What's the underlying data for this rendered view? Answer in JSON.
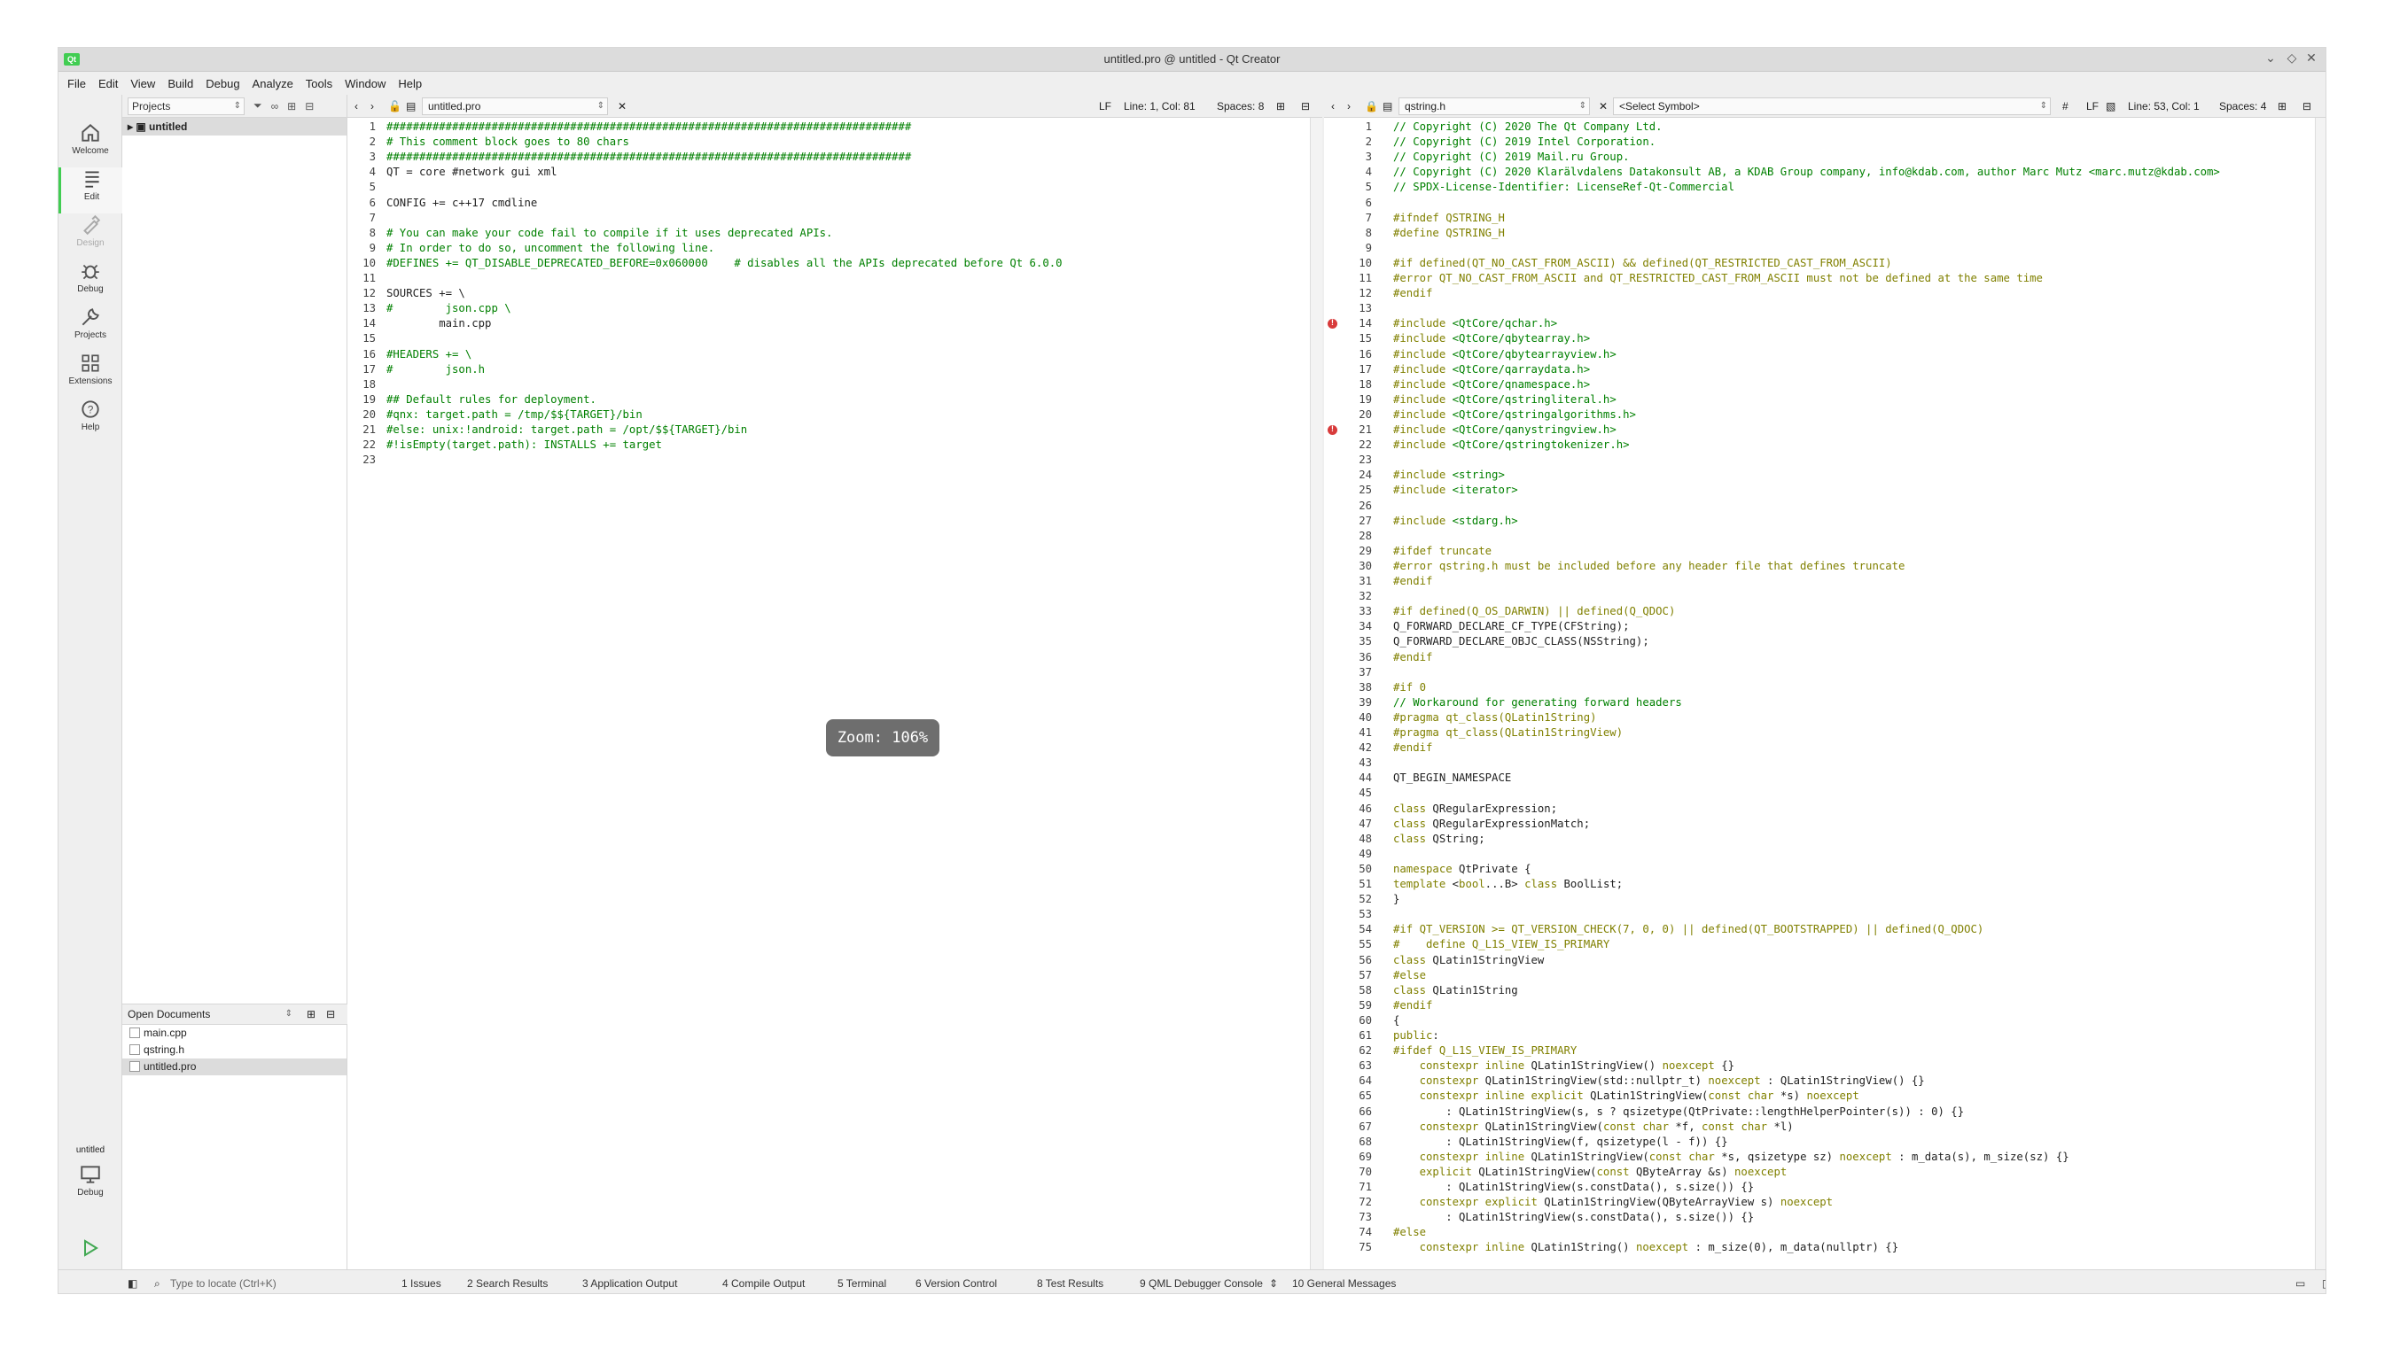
{
  "window": {
    "title": "untitled.pro @ untitled - Qt Creator",
    "app_icon": "qt-logo"
  },
  "menu": [
    "File",
    "Edit",
    "View",
    "Build",
    "Debug",
    "Analyze",
    "Tools",
    "Window",
    "Help"
  ],
  "modes": [
    {
      "label": "Welcome",
      "icon": "home-icon"
    },
    {
      "label": "Edit",
      "icon": "edit-icon",
      "selected": true
    },
    {
      "label": "Design",
      "icon": "design-icon",
      "disabled": true
    },
    {
      "label": "Debug",
      "icon": "bug-icon"
    },
    {
      "label": "Projects",
      "icon": "wrench-icon"
    },
    {
      "label": "Extensions",
      "icon": "extensions-icon"
    },
    {
      "label": "Help",
      "icon": "help-icon"
    }
  ],
  "kit": {
    "project": "untitled",
    "config": "Debug"
  },
  "projects": {
    "combo": "Projects",
    "root": "untitled"
  },
  "open_docs": {
    "combo": "Open Documents",
    "items": [
      "main.cpp",
      "qstring.h",
      "untitled.pro"
    ],
    "selected": 2
  },
  "left_editor": {
    "file": "untitled.pro",
    "line_ending": "LF",
    "cursor": "Line: 1, Col: 81",
    "spaces": "Spaces: 8"
  },
  "right_editor": {
    "file": "qstring.h",
    "symbol": "<Select Symbol>",
    "hash": "#",
    "line_ending": "LF",
    "cursor": "Line: 53, Col: 1",
    "spaces": "Spaces: 4"
  },
  "zoom": "Zoom: 106%",
  "left_code": [
    "################################################################################",
    "# This comment block goes to 80 chars",
    "################################################################################",
    "QT = core #network gui xml",
    "",
    "CONFIG += c++17 cmdline",
    "",
    "# You can make your code fail to compile if it uses deprecated APIs.",
    "# In order to do so, uncomment the following line.",
    "#DEFINES += QT_DISABLE_DEPRECATED_BEFORE=0x060000    # disables all the APIs deprecated before Qt 6.0.0",
    "",
    "SOURCES += \\",
    "#        json.cpp \\",
    "        main.cpp",
    "",
    "#HEADERS += \\",
    "#        json.h",
    "",
    "## Default rules for deployment.",
    "#qnx: target.path = /tmp/$${TARGET}/bin",
    "#else: unix:!android: target.path = /opt/$${TARGET}/bin",
    "#!isEmpty(target.path): INSTALLS += target",
    ""
  ],
  "right_code": [
    "// Copyright (C) 2020 The Qt Company Ltd.",
    "// Copyright (C) 2019 Intel Corporation.",
    "// Copyright (C) 2019 Mail.ru Group.",
    "// Copyright (C) 2020 Klarälvdalens Datakonsult AB, a KDAB Group company, info@kdab.com, author Marc Mutz <marc.mutz@kdab.com>",
    "// SPDX-License-Identifier: LicenseRef-Qt-Commercial",
    "",
    "#ifndef QSTRING_H",
    "#define QSTRING_H",
    "",
    "#if defined(QT_NO_CAST_FROM_ASCII) && defined(QT_RESTRICTED_CAST_FROM_ASCII)",
    "#error QT_NO_CAST_FROM_ASCII and QT_RESTRICTED_CAST_FROM_ASCII must not be defined at the same time",
    "#endif",
    "",
    "#include <QtCore/qchar.h>",
    "#include <QtCore/qbytearray.h>",
    "#include <QtCore/qbytearrayview.h>",
    "#include <QtCore/qarraydata.h>",
    "#include <QtCore/qnamespace.h>",
    "#include <QtCore/qstringliteral.h>",
    "#include <QtCore/qstringalgorithms.h>",
    "#include <QtCore/qanystringview.h>",
    "#include <QtCore/qstringtokenizer.h>",
    "",
    "#include <string>",
    "#include <iterator>",
    "",
    "#include <stdarg.h>",
    "",
    "#ifdef truncate",
    "#error qstring.h must be included before any header file that defines truncate",
    "#endif",
    "",
    "#if defined(Q_OS_DARWIN) || defined(Q_QDOC)",
    "Q_FORWARD_DECLARE_CF_TYPE(CFString);",
    "Q_FORWARD_DECLARE_OBJC_CLASS(NSString);",
    "#endif",
    "",
    "#if 0",
    "// Workaround for generating forward headers",
    "#pragma qt_class(QLatin1String)",
    "#pragma qt_class(QLatin1StringView)",
    "#endif",
    "",
    "QT_BEGIN_NAMESPACE",
    "",
    "class QRegularExpression;",
    "class QRegularExpressionMatch;",
    "class QString;",
    "",
    "namespace QtPrivate {",
    "template <bool...B> class BoolList;",
    "}",
    "",
    "#if QT_VERSION >= QT_VERSION_CHECK(7, 0, 0) || defined(QT_BOOTSTRAPPED) || defined(Q_QDOC)",
    "#    define Q_L1S_VIEW_IS_PRIMARY",
    "class QLatin1StringView",
    "#else",
    "class QLatin1String",
    "#endif",
    "{",
    "public:",
    "#ifdef Q_L1S_VIEW_IS_PRIMARY",
    "    constexpr inline QLatin1StringView() noexcept {}",
    "    constexpr QLatin1StringView(std::nullptr_t) noexcept : QLatin1StringView() {}",
    "    constexpr inline explicit QLatin1StringView(const char *s) noexcept",
    "        : QLatin1StringView(s, s ? qsizetype(QtPrivate::lengthHelperPointer(s)) : 0) {}",
    "    constexpr QLatin1StringView(const char *f, const char *l)",
    "        : QLatin1StringView(f, qsizetype(l - f)) {}",
    "    constexpr inline QLatin1StringView(const char *s, qsizetype sz) noexcept : m_data(s), m_size(sz) {}",
    "    explicit QLatin1StringView(const QByteArray &s) noexcept",
    "        : QLatin1StringView(s.constData(), s.size()) {}",
    "    constexpr explicit QLatin1StringView(QByteArrayView s) noexcept",
    "        : QLatin1StringView(s.constData(), s.size()) {}",
    "#else",
    "    constexpr inline QLatin1String() noexcept : m_size(0), m_data(nullptr) {}"
  ],
  "status": {
    "locator_placeholder": "Type to locate (Ctrl+K)",
    "panes": [
      "1 Issues",
      "2 Search Results",
      "3 Application Output",
      "4 Compile Output",
      "5 Terminal",
      "6 Version Control",
      "8 Test Results",
      "9 QML Debugger Console",
      "10 General Messages"
    ]
  }
}
